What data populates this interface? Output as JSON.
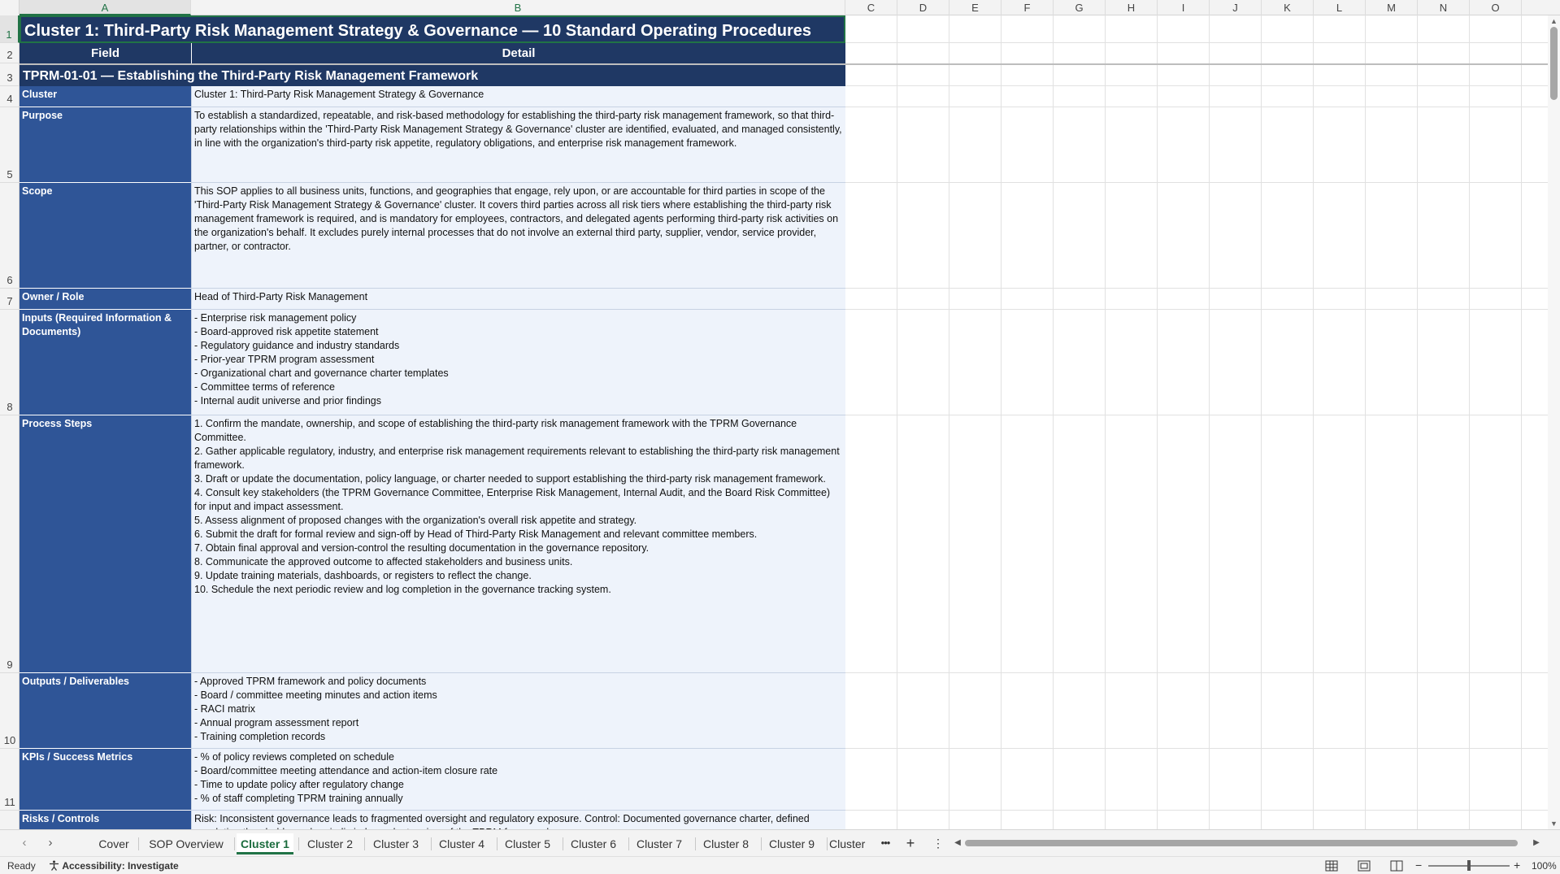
{
  "sheet": {
    "columns": [
      "A",
      "B",
      "C",
      "D",
      "E",
      "F",
      "G",
      "H",
      "I",
      "J",
      "K",
      "L",
      "M",
      "N",
      "O"
    ],
    "rows": [
      "1",
      "2",
      "3",
      "4",
      "5",
      "6",
      "7",
      "8",
      "9",
      "10",
      "11"
    ],
    "selected_column": "A",
    "selected_row": "1"
  },
  "cells": {
    "title": "Cluster 1: Third-Party Risk Management Strategy & Governance  —  10 Standard Operating Procedures",
    "header_field": "Field",
    "header_detail": "Detail",
    "sop_title": "TPRM-01-01  —  Establishing the Third-Party Risk Management Framework",
    "rows": [
      {
        "field": "Cluster",
        "detail": "Cluster 1: Third-Party Risk Management Strategy & Governance"
      },
      {
        "field": "Purpose",
        "detail": "To establish a standardized, repeatable, and risk-based methodology for establishing the third-party risk management framework, so that third-party relationships within the 'Third-Party Risk Management Strategy & Governance' cluster are identified, evaluated, and managed consistently, in line with the organization's third-party risk appetite, regulatory obligations, and enterprise risk management framework."
      },
      {
        "field": "Scope",
        "detail": "This SOP applies to all business units, functions, and geographies that engage, rely upon, or are accountable for third parties in scope of the 'Third-Party Risk Management Strategy & Governance' cluster. It covers third parties across all risk tiers where establishing the third-party risk management framework is required, and is mandatory for employees, contractors, and delegated agents performing third-party risk activities on the organization's behalf. It excludes purely internal processes that do not involve an external third party, supplier, vendor, service provider, partner, or contractor."
      },
      {
        "field": "Owner / Role",
        "detail": "Head of Third-Party Risk Management"
      },
      {
        "field": "Inputs (Required Information & Documents)",
        "detail": "- Enterprise risk management policy\n- Board-approved risk appetite statement\n- Regulatory guidance and industry standards\n- Prior-year TPRM program assessment\n- Organizational chart and governance charter templates\n- Committee terms of reference\n- Internal audit universe and prior findings"
      },
      {
        "field": "Process Steps",
        "detail": "1. Confirm the mandate, ownership, and scope of establishing the third-party risk management framework with the TPRM Governance Committee.\n2. Gather applicable regulatory, industry, and enterprise risk management requirements relevant to establishing the third-party risk management framework.\n3. Draft or update the documentation, policy language, or charter needed to support establishing the third-party risk management framework.\n4. Consult key stakeholders (the TPRM Governance Committee, Enterprise Risk Management, Internal Audit, and the Board Risk Committee) for input and impact assessment.\n5. Assess alignment of proposed changes with the organization's overall risk appetite and strategy.\n6. Submit the draft for formal review and sign-off by Head of Third-Party Risk Management and relevant committee members.\n7. Obtain final approval and version-control the resulting documentation in the governance repository.\n8. Communicate the approved outcome to affected stakeholders and business units.\n9. Update training materials, dashboards, or registers to reflect the change.\n10. Schedule the next periodic review and log completion in the governance tracking system."
      },
      {
        "field": "Outputs / Deliverables",
        "detail": "- Approved TPRM framework and policy documents\n- Board / committee meeting minutes and action items\n- RACI matrix\n- Annual program assessment report\n- Training completion records"
      },
      {
        "field": "KPIs / Success Metrics",
        "detail": "- % of policy reviews completed on schedule\n- Board/committee meeting attendance and action-item closure rate\n- Time to update policy after regulatory change\n- % of staff completing TPRM training annually"
      },
      {
        "field": "Risks / Controls",
        "detail": "Risk: Inconsistent governance leads to fragmented oversight and regulatory exposure. Control: Documented governance charter, defined escalation thresholds, and periodic independent review of the TPRM framework."
      }
    ]
  },
  "tabs": [
    "Cover",
    "SOP Overview",
    "Cluster 1",
    "Cluster 2",
    "Cluster 3",
    "Cluster 4",
    "Cluster 5",
    "Cluster 6",
    "Cluster 7",
    "Cluster 8",
    "Cluster 9",
    "Cluster"
  ],
  "active_tab": "Cluster 1",
  "status": {
    "ready": "Ready",
    "accessibility": "Accessibility: Investigate",
    "zoom": "100%"
  }
}
